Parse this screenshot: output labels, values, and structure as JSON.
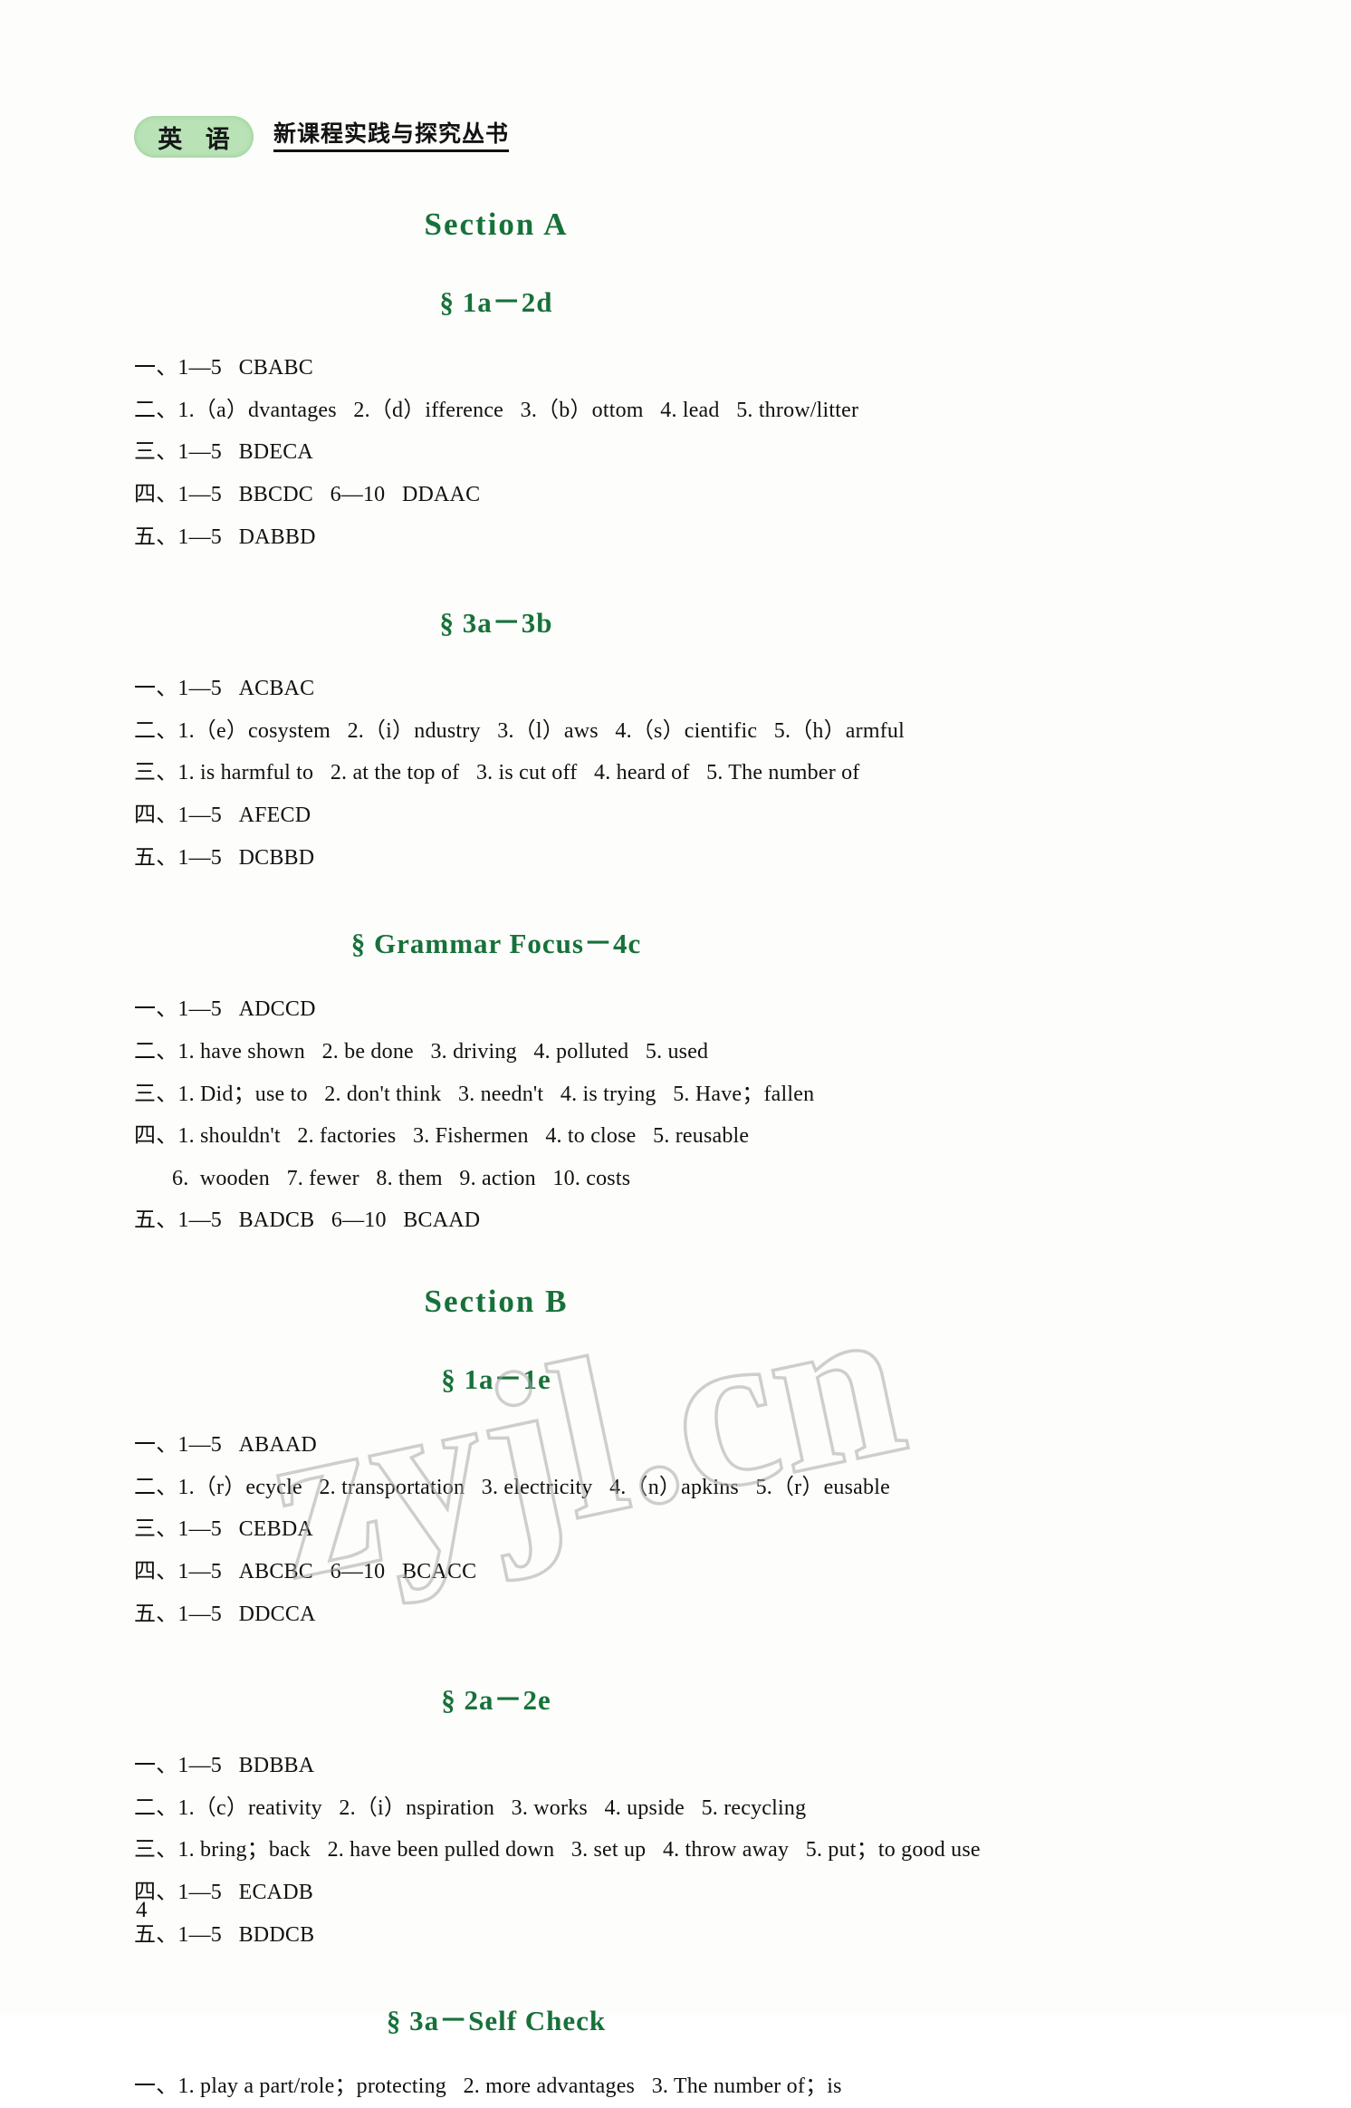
{
  "header": {
    "subject_badge": "英 语",
    "series_title": "新课程实践与探究丛书"
  },
  "page_number": "4",
  "watermark": {
    "text": "zyjl.cn"
  },
  "sections": [
    {
      "title": "Section A",
      "groups": [
        {
          "subtitle": "§ 1a－2d",
          "lines": [
            "一、1—5   CBABC",
            "二、1.（a）dvantages   2.（d）ifference   3.（b）ottom   4. lead   5. throw/litter",
            "三、1—5   BDECA",
            "四、1—5   BBCDC   6—10   DDAAC",
            "五、1—5   DABBD"
          ]
        },
        {
          "subtitle": "§ 3a－3b",
          "lines": [
            "一、1—5   ACBAC",
            "二、1.（e）cosystem   2.（i）ndustry   3.（l）aws   4.（s）cientific   5.（h）armful",
            "三、1. is harmful to   2. at the top of   3. is cut off   4. heard of   5. The number of",
            "四、1—5   AFECD",
            "五、1—5   DCBBD"
          ]
        },
        {
          "subtitle": "§ Grammar Focus－4c",
          "lines": [
            "一、1—5   ADCCD",
            "二、1. have shown   2. be done   3. driving   4. polluted   5. used",
            "三、1. Did；use to   2. don't think   3. needn't   4. is trying   5. Have；fallen",
            "四、1. shouldn't   2. factories   3. Fishermen   4. to close   5. reusable",
            "6.  wooden   7. fewer   8. them   9. action   10. costs",
            "五、1—5   BADCB   6—10   BCAAD"
          ],
          "indented_line_indexes": [
            4
          ]
        }
      ]
    },
    {
      "title": "Section B",
      "groups": [
        {
          "subtitle": "§ 1a－1e",
          "lines": [
            "一、1—5   ABAAD",
            "二、1.（r）ecycle   2. transportation   3. electricity   4.（n）apkins   5.（r）eusable",
            "三、1—5   CEBDA",
            "四、1—5   ABCBC   6—10   BCACC",
            "五、1—5   DDCCA"
          ]
        },
        {
          "subtitle": "§ 2a－2e",
          "lines": [
            "一、1—5   BDBBA",
            "二、1.（c）reativity   2.（i）nspiration   3. works   4. upside   5. recycling",
            "三、1. bring；back   2. have been pulled down   3. set up   4. throw away   5. put；to good use",
            "四、1—5   ECADB",
            "五、1—5   BDDCB"
          ]
        },
        {
          "subtitle": "§ 3a－Self Check",
          "lines": [
            "一、1. play a part/role；protecting   2. more advantages   3. The number of；is"
          ]
        }
      ]
    }
  ]
}
